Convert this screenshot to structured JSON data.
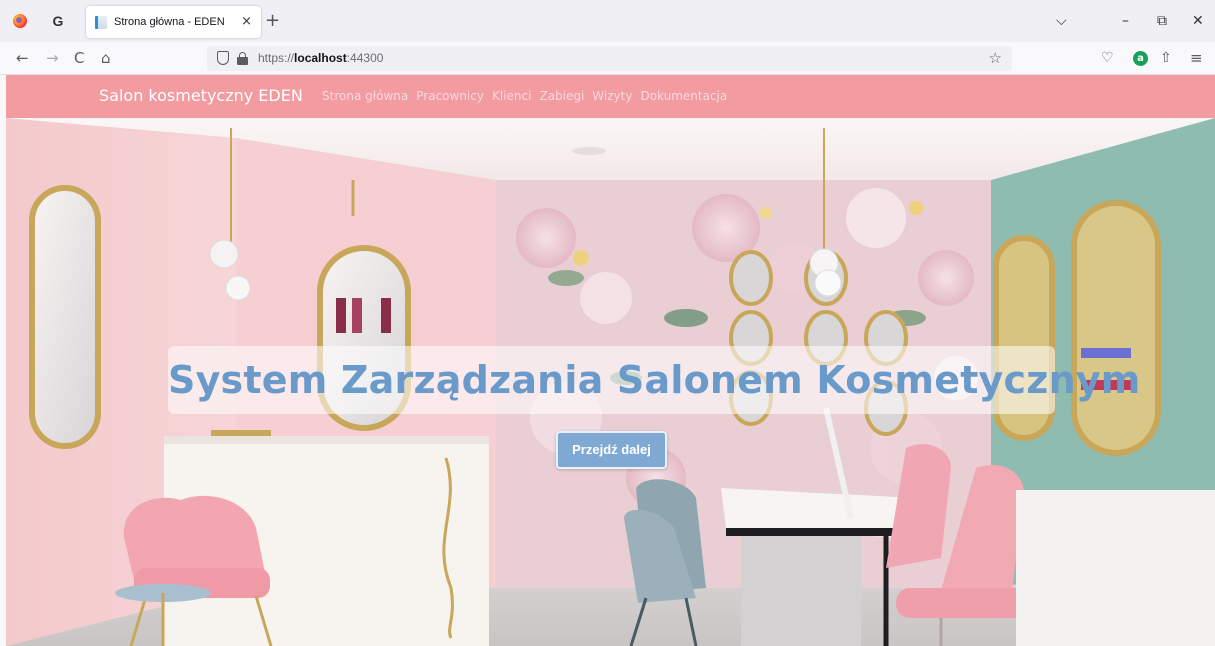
{
  "browser": {
    "tab_title": "Strona główna - EDEN",
    "tab_close": "×",
    "new_tab": "+",
    "url": {
      "protocol": "https://",
      "host": "localhost",
      "port": ":44300"
    },
    "icons": {
      "back": "←",
      "forward": "→",
      "reload": "C",
      "home": "⌂",
      "bookmark": "☆",
      "list_tabs": "⌵",
      "minimize": "–",
      "restore": "⧉",
      "close": "✕",
      "pocket": "♡",
      "ublock": "a",
      "extensions": "⇧",
      "menu": "≡"
    }
  },
  "site": {
    "brand": "Salon kosmetyczny EDEN",
    "nav": [
      "Strona główna",
      "Pracownicy",
      "Klienci",
      "Zabiegi",
      "Wizyty",
      "Dokumentacja"
    ],
    "nav_bg": "#f29ba0",
    "hero": {
      "headline": "System Zarządzania Salonem Kosmetycznym",
      "cta_label": "Przejdź dalej",
      "headline_color": "#6a9ac9",
      "cta_color": "#7fa9d2"
    }
  }
}
